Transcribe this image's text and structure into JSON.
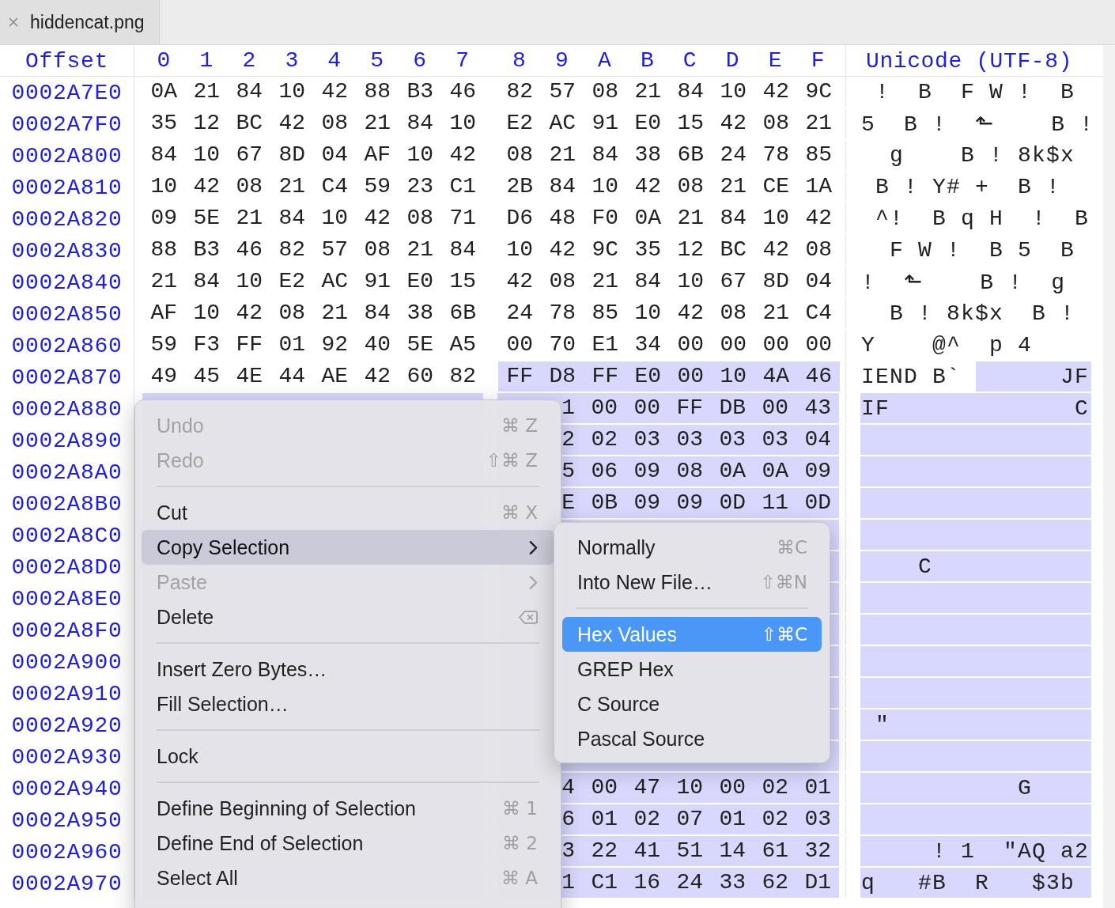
{
  "tabs": [
    {
      "label": "hiddencat.png",
      "selected": true
    }
  ],
  "hex_view": {
    "header": {
      "offset": "Offset",
      "columns": [
        "0",
        "1",
        "2",
        "3",
        "4",
        "5",
        "6",
        "7",
        "8",
        "9",
        "A",
        "B",
        "C",
        "D",
        "E",
        "F"
      ],
      "unicode": "Unicode (UTF-8)"
    },
    "rows": [
      {
        "offset": "0002A7E0",
        "selected": false,
        "unicode": " !  B  F W !  B",
        "bytes": [
          {
            "text": "0A",
            "selected": false
          },
          {
            "text": "21",
            "selected": false
          },
          {
            "text": "84",
            "selected": false
          },
          {
            "text": "10",
            "selected": false
          },
          {
            "text": "42",
            "selected": false
          },
          {
            "text": "88",
            "selected": false
          },
          {
            "text": "B3",
            "selected": false
          },
          {
            "text": "46",
            "selected": false
          },
          {
            "text": "82",
            "selected": false
          },
          {
            "text": "57",
            "selected": false
          },
          {
            "text": "08",
            "selected": false
          },
          {
            "text": "21",
            "selected": false
          },
          {
            "text": "84",
            "selected": false
          },
          {
            "text": "10",
            "selected": false
          },
          {
            "text": "42",
            "selected": false
          },
          {
            "text": "9C",
            "selected": false
          }
        ]
      },
      {
        "offset": "0002A7F0",
        "selected": false,
        "unicode": "5  B !  ⬑    B !",
        "bytes": [
          {
            "text": "35",
            "selected": false
          },
          {
            "text": "12",
            "selected": false
          },
          {
            "text": "BC",
            "selected": false
          },
          {
            "text": "42",
            "selected": false
          },
          {
            "text": "08",
            "selected": false
          },
          {
            "text": "21",
            "selected": false
          },
          {
            "text": "84",
            "selected": false
          },
          {
            "text": "10",
            "selected": false
          },
          {
            "text": "E2",
            "selected": false
          },
          {
            "text": "AC",
            "selected": false
          },
          {
            "text": "91",
            "selected": false
          },
          {
            "text": "E0",
            "selected": false
          },
          {
            "text": "15",
            "selected": false
          },
          {
            "text": "42",
            "selected": false
          },
          {
            "text": "08",
            "selected": false
          },
          {
            "text": "21",
            "selected": false
          }
        ]
      },
      {
        "offset": "0002A800",
        "selected": false,
        "unicode": "  g    B ! 8k$x",
        "bytes": [
          {
            "text": "84",
            "selected": false
          },
          {
            "text": "10",
            "selected": false
          },
          {
            "text": "67",
            "selected": false
          },
          {
            "text": "8D",
            "selected": false
          },
          {
            "text": "04",
            "selected": false
          },
          {
            "text": "AF",
            "selected": false
          },
          {
            "text": "10",
            "selected": false
          },
          {
            "text": "42",
            "selected": false
          },
          {
            "text": "08",
            "selected": false
          },
          {
            "text": "21",
            "selected": false
          },
          {
            "text": "84",
            "selected": false
          },
          {
            "text": "38",
            "selected": false
          },
          {
            "text": "6B",
            "selected": false
          },
          {
            "text": "24",
            "selected": false
          },
          {
            "text": "78",
            "selected": false
          },
          {
            "text": "85",
            "selected": false
          }
        ]
      },
      {
        "offset": "0002A810",
        "selected": false,
        "unicode": " B ! Y# +  B !",
        "bytes": [
          {
            "text": "10",
            "selected": false
          },
          {
            "text": "42",
            "selected": false
          },
          {
            "text": "08",
            "selected": false
          },
          {
            "text": "21",
            "selected": false
          },
          {
            "text": "C4",
            "selected": false
          },
          {
            "text": "59",
            "selected": false
          },
          {
            "text": "23",
            "selected": false
          },
          {
            "text": "C1",
            "selected": false
          },
          {
            "text": "2B",
            "selected": false
          },
          {
            "text": "84",
            "selected": false
          },
          {
            "text": "10",
            "selected": false
          },
          {
            "text": "42",
            "selected": false
          },
          {
            "text": "08",
            "selected": false
          },
          {
            "text": "21",
            "selected": false
          },
          {
            "text": "CE",
            "selected": false
          },
          {
            "text": "1A",
            "selected": false
          }
        ]
      },
      {
        "offset": "0002A820",
        "selected": false,
        "unicode": " ^!  B q H  !  B",
        "bytes": [
          {
            "text": "09",
            "selected": false
          },
          {
            "text": "5E",
            "selected": false
          },
          {
            "text": "21",
            "selected": false
          },
          {
            "text": "84",
            "selected": false
          },
          {
            "text": "10",
            "selected": false
          },
          {
            "text": "42",
            "selected": false
          },
          {
            "text": "08",
            "selected": false
          },
          {
            "text": "71",
            "selected": false
          },
          {
            "text": "D6",
            "selected": false
          },
          {
            "text": "48",
            "selected": false
          },
          {
            "text": "F0",
            "selected": false
          },
          {
            "text": "0A",
            "selected": false
          },
          {
            "text": "21",
            "selected": false
          },
          {
            "text": "84",
            "selected": false
          },
          {
            "text": "10",
            "selected": false
          },
          {
            "text": "42",
            "selected": false
          }
        ]
      },
      {
        "offset": "0002A830",
        "selected": false,
        "unicode": "  F W !  B 5  B",
        "bytes": [
          {
            "text": "88",
            "selected": false
          },
          {
            "text": "B3",
            "selected": false
          },
          {
            "text": "46",
            "selected": false
          },
          {
            "text": "82",
            "selected": false
          },
          {
            "text": "57",
            "selected": false
          },
          {
            "text": "08",
            "selected": false
          },
          {
            "text": "21",
            "selected": false
          },
          {
            "text": "84",
            "selected": false
          },
          {
            "text": "10",
            "selected": false
          },
          {
            "text": "42",
            "selected": false
          },
          {
            "text": "9C",
            "selected": false
          },
          {
            "text": "35",
            "selected": false
          },
          {
            "text": "12",
            "selected": false
          },
          {
            "text": "BC",
            "selected": false
          },
          {
            "text": "42",
            "selected": false
          },
          {
            "text": "08",
            "selected": false
          }
        ]
      },
      {
        "offset": "0002A840",
        "selected": false,
        "unicode": "!  ⬑    B !  g",
        "bytes": [
          {
            "text": "21",
            "selected": false
          },
          {
            "text": "84",
            "selected": false
          },
          {
            "text": "10",
            "selected": false
          },
          {
            "text": "E2",
            "selected": false
          },
          {
            "text": "AC",
            "selected": false
          },
          {
            "text": "91",
            "selected": false
          },
          {
            "text": "E0",
            "selected": false
          },
          {
            "text": "15",
            "selected": false
          },
          {
            "text": "42",
            "selected": false
          },
          {
            "text": "08",
            "selected": false
          },
          {
            "text": "21",
            "selected": false
          },
          {
            "text": "84",
            "selected": false
          },
          {
            "text": "10",
            "selected": false
          },
          {
            "text": "67",
            "selected": false
          },
          {
            "text": "8D",
            "selected": false
          },
          {
            "text": "04",
            "selected": false
          }
        ]
      },
      {
        "offset": "0002A850",
        "selected": false,
        "unicode": "  B ! 8k$x  B !",
        "bytes": [
          {
            "text": "AF",
            "selected": false
          },
          {
            "text": "10",
            "selected": false
          },
          {
            "text": "42",
            "selected": false
          },
          {
            "text": "08",
            "selected": false
          },
          {
            "text": "21",
            "selected": false
          },
          {
            "text": "84",
            "selected": false
          },
          {
            "text": "38",
            "selected": false
          },
          {
            "text": "6B",
            "selected": false
          },
          {
            "text": "24",
            "selected": false
          },
          {
            "text": "78",
            "selected": false
          },
          {
            "text": "85",
            "selected": false
          },
          {
            "text": "10",
            "selected": false
          },
          {
            "text": "42",
            "selected": false
          },
          {
            "text": "08",
            "selected": false
          },
          {
            "text": "21",
            "selected": false
          },
          {
            "text": "C4",
            "selected": false
          }
        ]
      },
      {
        "offset": "0002A860",
        "selected": false,
        "unicode": "Y    @^  p 4",
        "bytes": [
          {
            "text": "59",
            "selected": false
          },
          {
            "text": "F3",
            "selected": false
          },
          {
            "text": "FF",
            "selected": false
          },
          {
            "text": "01",
            "selected": false
          },
          {
            "text": "92",
            "selected": false
          },
          {
            "text": "40",
            "selected": false
          },
          {
            "text": "5E",
            "selected": false
          },
          {
            "text": "A5",
            "selected": false
          },
          {
            "text": "00",
            "selected": false
          },
          {
            "text": "70",
            "selected": false
          },
          {
            "text": "E1",
            "selected": false
          },
          {
            "text": "34",
            "selected": false
          },
          {
            "text": "00",
            "selected": false
          },
          {
            "text": "00",
            "selected": false
          },
          {
            "text": "00",
            "selected": false
          },
          {
            "text": "00",
            "selected": false
          }
        ]
      },
      {
        "offset": "0002A870",
        "selected": false,
        "unicode": "IEND B`       JF",
        "bytes": [
          {
            "text": "49",
            "selected": false
          },
          {
            "text": "45",
            "selected": false
          },
          {
            "text": "4E",
            "selected": false
          },
          {
            "text": "44",
            "selected": false
          },
          {
            "text": "AE",
            "selected": false
          },
          {
            "text": "42",
            "selected": false
          },
          {
            "text": "60",
            "selected": false
          },
          {
            "text": "82",
            "selected": false
          },
          {
            "text": "FF",
            "selected": true
          },
          {
            "text": "D8",
            "selected": true
          },
          {
            "text": "FF",
            "selected": true
          },
          {
            "text": "E0",
            "selected": true
          },
          {
            "text": "00",
            "selected": true
          },
          {
            "text": "10",
            "selected": true
          },
          {
            "text": "4A",
            "selected": true
          },
          {
            "text": "46",
            "selected": true
          }
        ]
      },
      {
        "offset": "0002A880",
        "selected": true,
        "unicode": "IF             C",
        "bytes": [
          {
            "text": "1",
            "selected": true
          },
          {
            "text": "00",
            "selected": true
          },
          {
            "text": "00",
            "selected": true
          },
          {
            "text": "FF",
            "selected": true
          },
          {
            "text": "DB",
            "selected": true
          },
          {
            "text": "00",
            "selected": true
          },
          {
            "text": "43",
            "selected": true
          }
        ]
      },
      {
        "offset": "0002A890",
        "selected": true,
        "bytes": [
          {
            "text": "2",
            "selected": true
          },
          {
            "text": "02",
            "selected": true
          },
          {
            "text": "03",
            "selected": true
          },
          {
            "text": "03",
            "selected": true
          },
          {
            "text": "03",
            "selected": true
          },
          {
            "text": "03",
            "selected": true
          },
          {
            "text": "04",
            "selected": true
          }
        ]
      },
      {
        "offset": "0002A8A0",
        "selected": true,
        "bytes": [
          {
            "text": "5",
            "selected": true
          },
          {
            "text": "06",
            "selected": true
          },
          {
            "text": "09",
            "selected": true
          },
          {
            "text": "08",
            "selected": true
          },
          {
            "text": "0A",
            "selected": true
          },
          {
            "text": "0A",
            "selected": true
          },
          {
            "text": "09",
            "selected": true
          }
        ]
      },
      {
        "offset": "0002A8B0",
        "selected": true,
        "bytes": [
          {
            "text": "E",
            "selected": true
          },
          {
            "text": "0B",
            "selected": true
          },
          {
            "text": "09",
            "selected": true
          },
          {
            "text": "09",
            "selected": true
          },
          {
            "text": "0D",
            "selected": true
          },
          {
            "text": "11",
            "selected": true
          },
          {
            "text": "0D",
            "selected": true
          }
        ]
      },
      {
        "offset": "0002A8C0",
        "selected": true
      },
      {
        "offset": "0002A8D0",
        "selected": true,
        "unicode": "    C"
      },
      {
        "offset": "0002A8E0",
        "selected": true
      },
      {
        "offset": "0002A8F0",
        "selected": true
      },
      {
        "offset": "0002A900",
        "selected": true
      },
      {
        "offset": "0002A910",
        "selected": true
      },
      {
        "offset": "0002A920",
        "selected": true,
        "unicode": " \""
      },
      {
        "offset": "0002A930",
        "selected": true
      },
      {
        "offset": "0002A940",
        "selected": true,
        "unicode": "           G",
        "bytes": [
          {
            "text": "4",
            "selected": true
          },
          {
            "text": "00",
            "selected": true
          },
          {
            "text": "47",
            "selected": true
          },
          {
            "text": "10",
            "selected": true
          },
          {
            "text": "00",
            "selected": true
          },
          {
            "text": "02",
            "selected": true
          },
          {
            "text": "01",
            "selected": true
          }
        ]
      },
      {
        "offset": "0002A950",
        "selected": true,
        "bytes": [
          {
            "text": "6",
            "selected": true
          },
          {
            "text": "01",
            "selected": true
          },
          {
            "text": "02",
            "selected": true
          },
          {
            "text": "07",
            "selected": true
          },
          {
            "text": "01",
            "selected": true
          },
          {
            "text": "02",
            "selected": true
          },
          {
            "text": "03",
            "selected": true
          }
        ]
      },
      {
        "offset": "0002A960",
        "selected": true,
        "unicode": "     ! 1  \"AQ a2",
        "bytes": [
          {
            "text": "3",
            "selected": true
          },
          {
            "text": "22",
            "selected": true
          },
          {
            "text": "41",
            "selected": true
          },
          {
            "text": "51",
            "selected": true
          },
          {
            "text": "14",
            "selected": true
          },
          {
            "text": "61",
            "selected": true
          },
          {
            "text": "32",
            "selected": true
          }
        ]
      },
      {
        "offset": "0002A970",
        "selected": true,
        "unicode": "q   #B  R   $3b",
        "bytes": [
          {
            "text": "1",
            "selected": true
          },
          {
            "text": "C1",
            "selected": true
          },
          {
            "text": "16",
            "selected": true
          },
          {
            "text": "24",
            "selected": true
          },
          {
            "text": "33",
            "selected": true
          },
          {
            "text": "62",
            "selected": true
          },
          {
            "text": "D1",
            "selected": true
          }
        ]
      }
    ]
  },
  "context_menu": {
    "items": [
      {
        "kind": "item",
        "label": "Undo",
        "shortcut": "⌘ Z",
        "disabled": true,
        "selected": false
      },
      {
        "kind": "item",
        "label": "Redo",
        "shortcut": "⇧⌘ Z",
        "disabled": true,
        "selected": false
      },
      {
        "kind": "separator"
      },
      {
        "kind": "item",
        "label": "Cut",
        "shortcut": "⌘ X",
        "disabled": false,
        "selected": false
      },
      {
        "kind": "submenu",
        "label": "Copy Selection",
        "disabled": false,
        "selected": true
      },
      {
        "kind": "submenu",
        "label": "Paste",
        "disabled": true,
        "selected": false
      },
      {
        "kind": "delete",
        "label": "Delete",
        "disabled": false,
        "selected": false
      },
      {
        "kind": "separator"
      },
      {
        "kind": "item",
        "label": "Insert Zero Bytes…",
        "disabled": false,
        "selected": false
      },
      {
        "kind": "item",
        "label": "Fill Selection…",
        "disabled": false,
        "selected": false
      },
      {
        "kind": "separator"
      },
      {
        "kind": "item",
        "label": "Lock",
        "disabled": false,
        "selected": false
      },
      {
        "kind": "separator"
      },
      {
        "kind": "item",
        "label": "Define Beginning of Selection",
        "shortcut": "⌘ 1",
        "disabled": false,
        "selected": false
      },
      {
        "kind": "item",
        "label": "Define End of Selection",
        "shortcut": "⌘ 2",
        "disabled": false,
        "selected": false
      },
      {
        "kind": "item",
        "label": "Select All",
        "shortcut": "⌘ A",
        "disabled": false,
        "selected": false
      }
    ]
  },
  "submenu": {
    "items": [
      {
        "kind": "item",
        "label": "Normally",
        "shortcut": "⌘C",
        "disabled": false,
        "selected": false
      },
      {
        "kind": "item",
        "label": "Into New File…",
        "shortcut": "⇧⌘N",
        "disabled": false,
        "selected": false
      },
      {
        "kind": "separator"
      },
      {
        "kind": "item",
        "label": "Hex Values",
        "shortcut": "⇧⌘C",
        "disabled": false,
        "selected": true
      },
      {
        "kind": "item",
        "label": "GREP Hex",
        "disabled": false,
        "selected": false
      },
      {
        "kind": "item",
        "label": "C Source",
        "disabled": false,
        "selected": false
      },
      {
        "kind": "item",
        "label": "Pascal Source",
        "disabled": false,
        "selected": false
      }
    ]
  }
}
